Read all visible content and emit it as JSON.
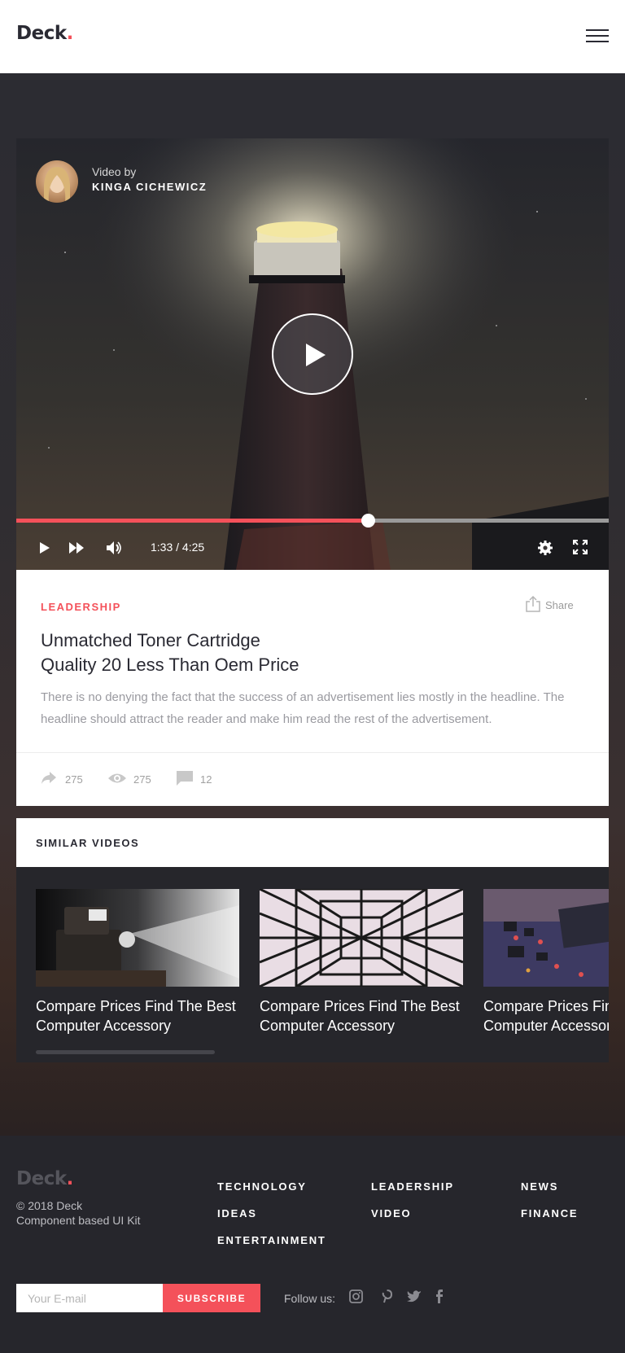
{
  "header": {
    "logo": "Deck",
    "logo_dot": ".",
    "menu_icon": "hamburger-icon"
  },
  "video": {
    "author_label": "Video by",
    "author_name": "KINGA CICHEWICZ",
    "progress": 0.593,
    "time": "1:33 / 4:25",
    "icons": [
      "play-icon",
      "fast-forward-icon",
      "volume-icon",
      "settings-icon",
      "fullscreen-icon"
    ]
  },
  "article": {
    "category": "LEADERSHIP",
    "share_label": "Share",
    "title_line1": "Unmatched Toner Cartridge",
    "title_line2": "Quality 20 Less Than Oem Price",
    "description": "There is no denying the fact that the success of an advertisement lies mostly in the headline. The headline should attract the reader and make him read the rest of the advertisement.",
    "shares": "275",
    "views": "275",
    "comments": "12"
  },
  "similar": {
    "heading": "SIMILAR VIDEOS",
    "items": [
      {
        "title": "Compare Prices Find The Best Computer Accessory",
        "thumb": "projector"
      },
      {
        "title": "Compare Prices Find The Best Computer Accessory",
        "thumb": "pylon"
      },
      {
        "title": "Compare Prices Find The Best Computer Accessory",
        "thumb": "circuit-board"
      }
    ]
  },
  "footer": {
    "logo": "Deck",
    "logo_dot": ".",
    "copyright": "© 2018 Deck",
    "tagline": "Component based UI Kit",
    "nav": [
      "TECHNOLOGY",
      "LEADERSHIP",
      "NEWS",
      "IDEAS",
      "VIDEO",
      "FINANCE",
      "ENTERTAINMENT"
    ],
    "email_placeholder": "Your E-mail",
    "subscribe_label": "SUBSCRIBE",
    "follow_label": "Follow us:",
    "social": [
      "instagram-icon",
      "pinterest-icon",
      "twitter-icon",
      "facebook-icon"
    ]
  },
  "colors": {
    "accent": "#f4515a",
    "dark": "#2a2a33",
    "footer_bg": "#26262c"
  }
}
